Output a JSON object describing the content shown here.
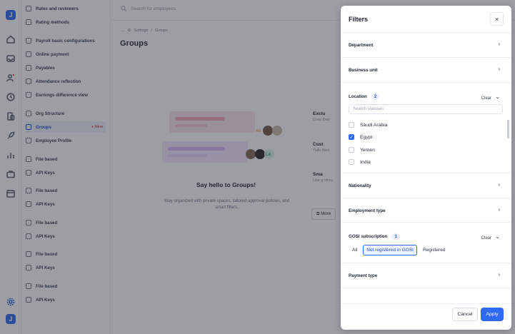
{
  "sidebar": {
    "items": [
      {
        "label": "Rates and reviewers"
      },
      {
        "label": "Rating methods"
      },
      {
        "label": "Payroll basic configurations"
      },
      {
        "label": "Online payment"
      },
      {
        "label": "Payables"
      },
      {
        "label": "Attendance reflection"
      },
      {
        "label": "Earnings difference view"
      },
      {
        "label": "Org Structure"
      },
      {
        "label": "Groups",
        "badge": "New"
      },
      {
        "label": "Employee Profile"
      },
      {
        "label": "File based"
      },
      {
        "label": "API Keys"
      },
      {
        "label": "File based"
      },
      {
        "label": "API Keys"
      },
      {
        "label": "File based"
      },
      {
        "label": "API Keys"
      },
      {
        "label": "File based"
      },
      {
        "label": "API Keys"
      },
      {
        "label": "File based"
      },
      {
        "label": "API Keys"
      }
    ]
  },
  "main": {
    "search_placeholder": "Search for employees",
    "breadcrumb": [
      "Settings",
      "Groups"
    ],
    "title": "Groups",
    "empty_title": "Say hello to Groups!",
    "empty_desc": "Stay organized with private spaces, tailored approval policies, and smart filters.",
    "features": [
      {
        "title": "Exclu",
        "desc": "Crea their"
      },
      {
        "title": "Cust",
        "desc": "Tailo their"
      },
      {
        "title": "Sma",
        "desc": "Use g strea"
      }
    ],
    "more_label": "More",
    "illus_labels": [
      "An",
      "LA"
    ]
  },
  "filters": {
    "title": "Filters",
    "close_glyph": "×",
    "sections": {
      "department": "Department",
      "business_unit": "Business unit",
      "location": "Location",
      "location_count": "2",
      "nationality": "Nationality",
      "employment_type": "Employment type",
      "gosi": "GOSI subscription",
      "gosi_count": "1",
      "payment_type": "Payment type"
    },
    "clear_label": "Clear",
    "location_search_placeholder": "Search statuses",
    "locations": [
      {
        "label": "Saudi Arabia",
        "checked": false
      },
      {
        "label": "Egypt",
        "checked": true
      },
      {
        "label": "Yemen",
        "checked": false
      },
      {
        "label": "India",
        "checked": false
      }
    ],
    "gosi_options": [
      "All",
      "Not registered in GOSI",
      "Registered"
    ],
    "gosi_selected": "Not registered in GOSI",
    "cancel_label": "Cancel",
    "apply_label": "Apply"
  },
  "colors": {
    "accent": "#2f6bf0",
    "overlay": "#232832"
  }
}
